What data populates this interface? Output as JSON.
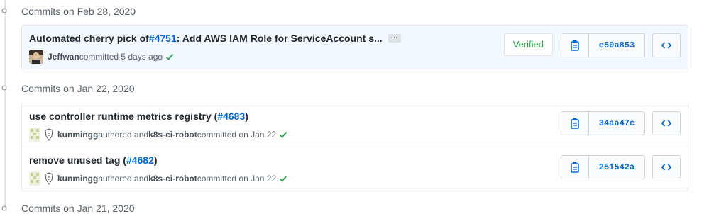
{
  "groups": [
    {
      "title": "Commits on Feb 28, 2020",
      "commits": [
        {
          "title_prefix": "Automated cherry pick of ",
          "title_link": "#4751",
          "title_suffix": ": Add AWS IAM Role for ServiceAccount s...",
          "author": "Jeffwan",
          "action": " committed 5 days ago",
          "verified_label": "Verified",
          "sha": "e50a853"
        }
      ]
    },
    {
      "title": "Commits on Jan 22, 2020",
      "commits": [
        {
          "title_prefix": "use controller runtime metrics registry (",
          "title_link": "#4683",
          "title_suffix": ")",
          "author": "kunmingg",
          "authored_text": " authored and ",
          "committer": "k8s-ci-robot",
          "action": " committed on Jan 22",
          "sha": "34aa47c"
        },
        {
          "title_prefix": "remove unused tag (",
          "title_link": "#4682",
          "title_suffix": ")",
          "author": "kunmingg",
          "authored_text": " authored and ",
          "committer": "k8s-ci-robot",
          "action": " committed on Jan 22",
          "sha": "251542a"
        }
      ]
    },
    {
      "title": "Commits on Jan 21, 2020",
      "commits": []
    }
  ],
  "icons": {
    "copy": "clippy-icon",
    "browse": "code-icon",
    "check": "check-icon",
    "ellipsis": "ellipsis-icon"
  },
  "colors": {
    "link": "#0366d6",
    "success": "#28a745",
    "highlight": "#f1f8ff",
    "border": "#e1e4e8"
  }
}
